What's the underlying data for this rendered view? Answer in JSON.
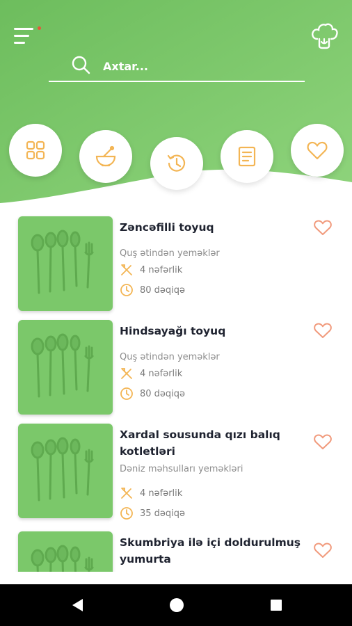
{
  "header": {
    "menu_icon": "hamburger-menu-icon",
    "notification_dot_color": "#e8553b",
    "chef_icon": "chef-hat-icon",
    "accent": "#7bc86a"
  },
  "search": {
    "placeholder": "Axtar...",
    "value": ""
  },
  "categories": [
    {
      "icon": "grid-icon"
    },
    {
      "icon": "mortar-pestle-icon"
    },
    {
      "icon": "history-clock-icon"
    },
    {
      "icon": "document-list-icon"
    },
    {
      "icon": "heart-icon"
    }
  ],
  "recipes": [
    {
      "title": "Zəncəfilli toyuq",
      "category": "Quş ətindən yeməklər",
      "servings": "4 nəfərlik",
      "time": "80 dəqiqə",
      "favorite": false
    },
    {
      "title": "Hindsayağı toyuq",
      "category": "Quş ətindən yeməklər",
      "servings": "4 nəfərlik",
      "time": "80 dəqiqə",
      "favorite": false
    },
    {
      "title": "Xardal sousunda qızı balıq kotletləri",
      "category": "Dəniz məhsulları yeməkləri",
      "servings": "4 nəfərlik",
      "time": "35 dəqiqə",
      "favorite": false
    },
    {
      "title": "Skumbriya ilə içi doldurulmuş yumurta",
      "category": "",
      "servings": "",
      "time": "",
      "favorite": false
    }
  ],
  "colors": {
    "icon_orange": "#f3b554",
    "heart": "#f19a7c",
    "title": "#1f2330"
  },
  "system_nav": {
    "back": "back-triangle-icon",
    "home": "home-circle-icon",
    "recents": "recents-square-icon"
  }
}
